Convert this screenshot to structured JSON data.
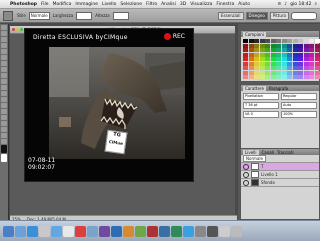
{
  "menubar": {
    "app": "Photoshop",
    "items": [
      "File",
      "Modifica",
      "Immagine",
      "Livello",
      "Selezione",
      "Filtro",
      "Analisi",
      "3D",
      "Visualizza",
      "Finestra",
      "Aiuto"
    ],
    "clock": "gio 18:42"
  },
  "options": {
    "labels": [
      "Stile",
      "Normale",
      "Larghezza",
      "Altezza"
    ],
    "workspaces": [
      "Essenziali",
      "Disegno",
      "Pittura"
    ],
    "active_workspace": "Disegno"
  },
  "document": {
    "tab_title": "cocodrillo.psd @ 25% (T, RGB/8)"
  },
  "video": {
    "caption": "Diretta ESCLUSIVA byCIMque",
    "rec": "REC",
    "date": "07-08-11",
    "time": "09:02:07",
    "sign_line1": "TG",
    "sign_line2": "CIMue"
  },
  "status": {
    "zoom": "25%",
    "doc": "Doc: 1,49 M/5,04 M"
  },
  "panels": {
    "swatches_tab": "Campioni",
    "char_tabs": [
      "Carattere",
      "Paragrafo"
    ],
    "char_fields": [
      "Pixellation",
      "Regular",
      "T 36 pt",
      "Auto",
      "VA 0",
      "100%"
    ],
    "layers_tabs": [
      "Livelli",
      "Canali",
      "Tracciati"
    ],
    "blend_mode": "Normale",
    "layers": [
      {
        "name": "T",
        "selected": true
      },
      {
        "name": "Livello 1",
        "selected": false
      },
      {
        "name": "Sfondo",
        "selected": false
      }
    ]
  },
  "colors": {
    "rec": "#e01010",
    "layer_selected": "#d9a8e4"
  }
}
